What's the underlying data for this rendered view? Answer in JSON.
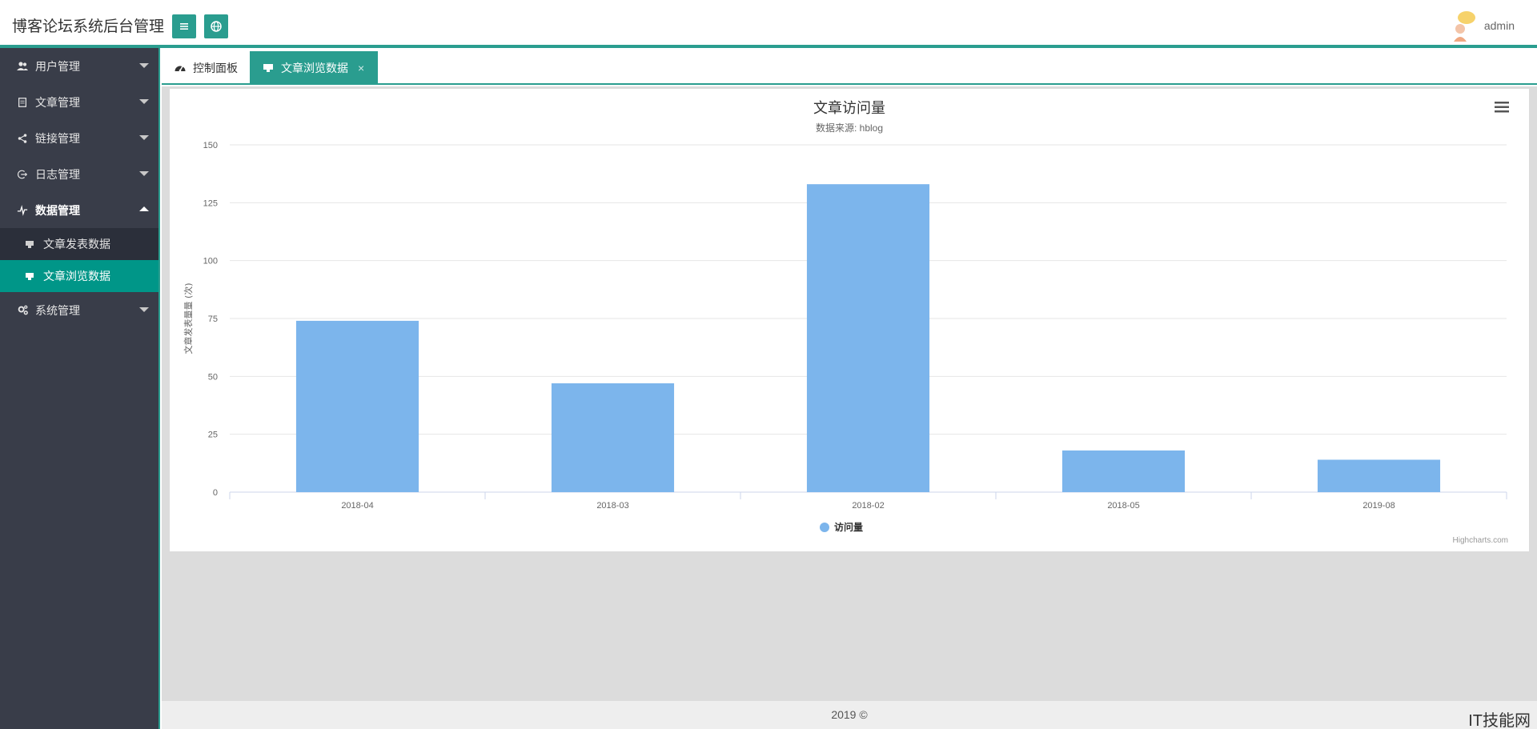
{
  "header": {
    "title": "博客论坛系统后台管理",
    "user_name": "admin"
  },
  "sidebar": {
    "items": [
      {
        "label": "用户管理",
        "icon": "users-icon"
      },
      {
        "label": "文章管理",
        "icon": "document-icon"
      },
      {
        "label": "链接管理",
        "icon": "share-icon"
      },
      {
        "label": "日志管理",
        "icon": "logout-icon"
      },
      {
        "label": "数据管理",
        "icon": "pulse-icon"
      },
      {
        "label": "系统管理",
        "icon": "cogs-icon"
      }
    ],
    "sub_items": [
      {
        "label": "文章发表数据",
        "icon": "chart-icon"
      },
      {
        "label": "文章浏览数据",
        "icon": "chart-icon"
      }
    ]
  },
  "tabs": [
    {
      "label": "控制面板",
      "icon": "dashboard-icon"
    },
    {
      "label": "文章浏览数据",
      "icon": "chart-icon",
      "close": "×"
    }
  ],
  "chart_data": {
    "type": "bar",
    "title": "文章访问量",
    "subtitle": "数据来源: hblog",
    "ylabel": "文章发表量量 (次)",
    "categories": [
      "2018-04",
      "2018-03",
      "2018-02",
      "2018-05",
      "2019-08"
    ],
    "series": [
      {
        "name": "访问量",
        "values": [
          74,
          47,
          133,
          18,
          14
        ],
        "color": "#7cb5ec"
      }
    ],
    "ylim": [
      0,
      150
    ],
    "yticks": [
      0,
      25,
      50,
      75,
      100,
      125,
      150
    ],
    "grid": true,
    "legend_position": "bottom-center",
    "credit": "Highcharts.com"
  },
  "footer": {
    "text": "2019 ©"
  },
  "watermark": "IT技能网",
  "colors": {
    "accent": "#2a9d8f",
    "sidebar_bg": "#393d49",
    "active_sub": "#009688",
    "bar": "#7cb5ec"
  }
}
